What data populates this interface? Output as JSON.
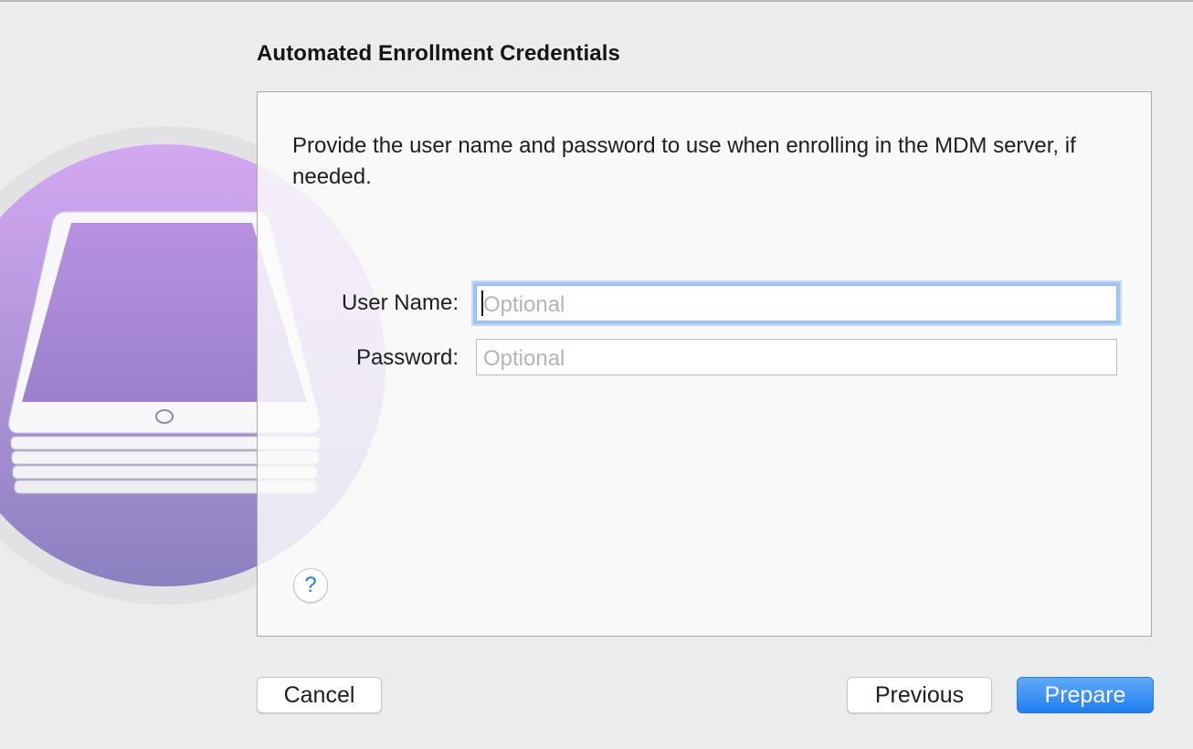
{
  "dialog": {
    "title": "Automated Enrollment Credentials",
    "instructions": "Provide the user name and password to use when enrolling in the MDM server, if needed."
  },
  "form": {
    "user_name_label": "User Name:",
    "user_name_value": "",
    "user_name_placeholder": "Optional",
    "password_label": "Password:",
    "password_value": "",
    "password_placeholder": "Optional"
  },
  "help": {
    "label": "?"
  },
  "buttons": {
    "cancel": "Cancel",
    "previous": "Previous",
    "prepare": "Prepare"
  },
  "colors": {
    "accent": "#1f7ef0",
    "focus_ring": "#a3c7f5",
    "art_purple_top": "#d3a8f2",
    "art_purple_bottom": "#8c80c0"
  },
  "icons": {
    "artwork": "ipad-stack-icon",
    "help": "help-icon"
  }
}
